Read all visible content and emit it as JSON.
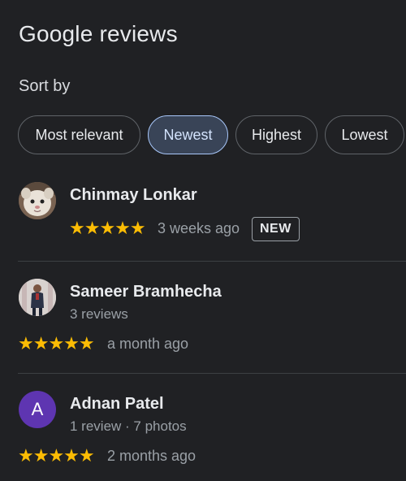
{
  "header": {
    "title": "Google reviews",
    "sort_label": "Sort by"
  },
  "sort_options": [
    {
      "label": "Most relevant",
      "selected": false
    },
    {
      "label": "Newest",
      "selected": true
    },
    {
      "label": "Highest",
      "selected": false
    },
    {
      "label": "Lowest",
      "selected": false
    }
  ],
  "reviews": [
    {
      "name": "Chinmay Lonkar",
      "meta": "",
      "stars": "★★★★★",
      "rating": 5,
      "time": "3 weeks ago",
      "badge": "NEW",
      "avatar": "photo-cat"
    },
    {
      "name": "Sameer Bramhecha",
      "meta": "3 reviews",
      "stars": "★★★★★",
      "rating": 5,
      "time": "a month ago",
      "avatar": "photo-person"
    },
    {
      "name": "Adnan Patel",
      "meta": "1 review · 7 photos",
      "stars": "★★★★★",
      "rating": 5,
      "time": "2 months ago",
      "avatar_letter": "A"
    }
  ],
  "colors": {
    "background": "#202124",
    "star": "#fbbc04",
    "selected_chip_bg": "#394457",
    "selected_chip_border": "#a8c7fa",
    "letter_avatar": "#5e35b1"
  }
}
